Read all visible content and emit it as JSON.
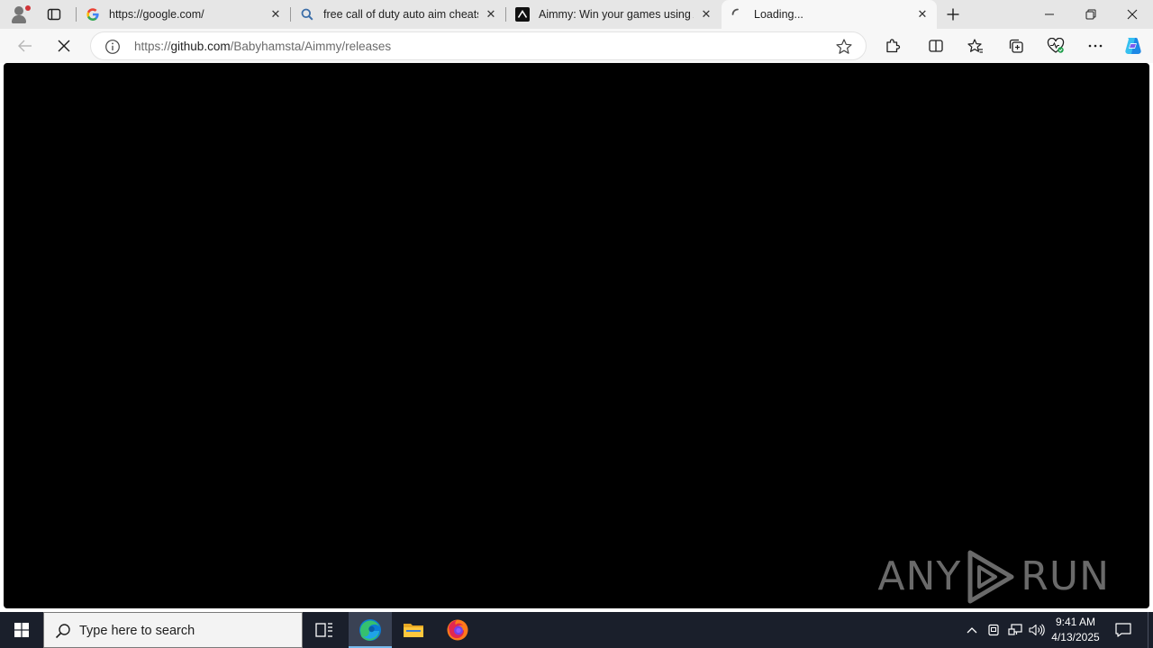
{
  "browser": {
    "tabs": [
      {
        "title": "https://google.com/",
        "favicon": "google-g-icon",
        "active": false
      },
      {
        "title": "free call of duty auto aim cheats",
        "favicon": "search-icon",
        "active": false
      },
      {
        "title": "Aimmy: Win your games using AI",
        "favicon": "aimmy-logo-icon",
        "active": false
      },
      {
        "title": "Loading...",
        "favicon": "loading-spinner-icon",
        "active": true
      }
    ],
    "address_bar": {
      "scheme": "https://",
      "host": "github.com",
      "path": "/Babyhamsta/Aimmy/releases"
    }
  },
  "watermark": {
    "left": "ANY",
    "right": "RUN"
  },
  "taskbar": {
    "search_placeholder": "Type here to search",
    "time": "9:41 AM",
    "date": "4/13/2025"
  },
  "colors": {
    "tabstrip_bg": "#e6e6e6",
    "toolbar_bg": "#f7f7f7",
    "content_bg": "#000000",
    "taskbar_bg": "#1a1f2b",
    "copilot_accent": "#1e88e5"
  }
}
